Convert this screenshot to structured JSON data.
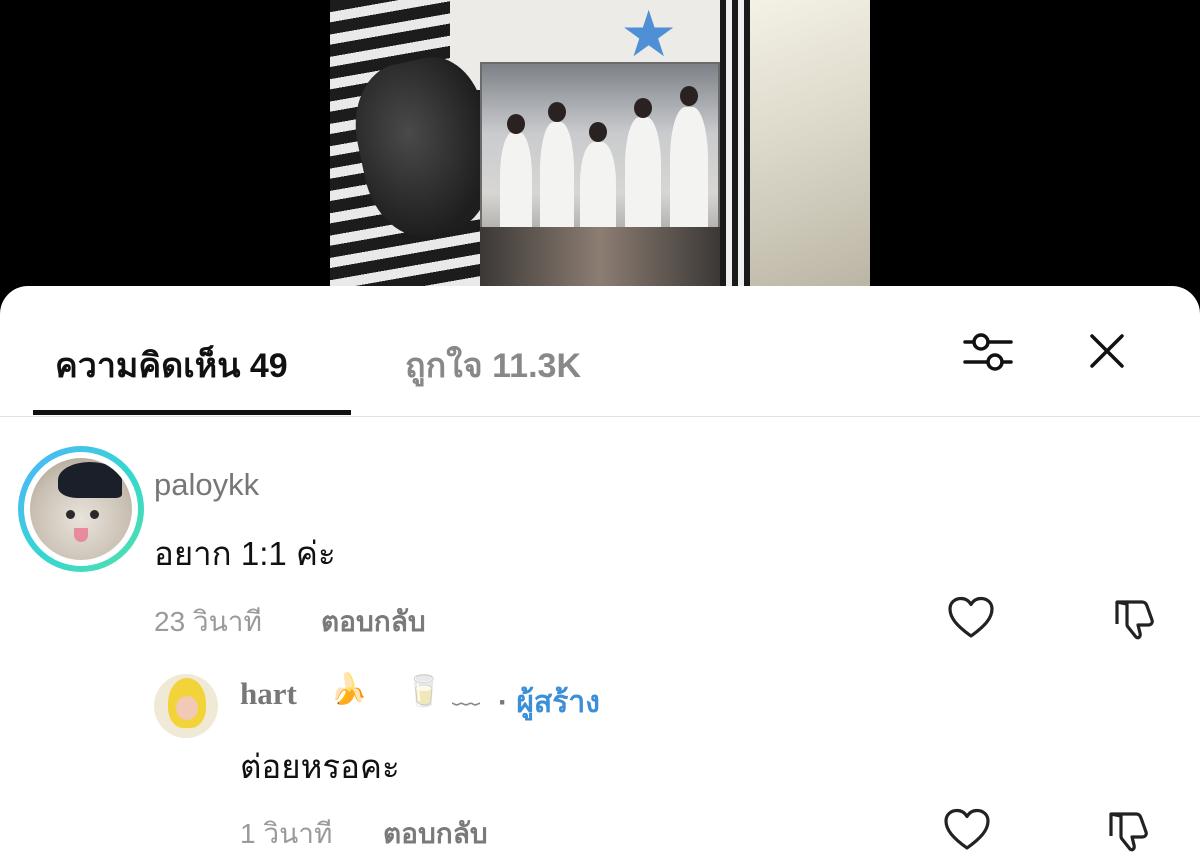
{
  "video": {
    "description_icon": "video-thumbnail"
  },
  "tabs": {
    "comments_label": "ความคิดเห็น 49",
    "likes_label": "ถูกใจ 11.3K"
  },
  "toolbar": {
    "filter_icon": "sliders-icon",
    "close_icon": "close-icon"
  },
  "comments": [
    {
      "username": "paloykk",
      "text": "อยาก 1:1 ค่ะ",
      "time": "23 วินาที",
      "reply_label": "ตอบกลับ"
    },
    {
      "username": "hart",
      "creator_sep": "·",
      "creator_label": "ผู้สร้าง",
      "text": "ต่อยหรอคะ",
      "time": "1 วินาที",
      "reply_label": "ตอบกลับ"
    }
  ]
}
